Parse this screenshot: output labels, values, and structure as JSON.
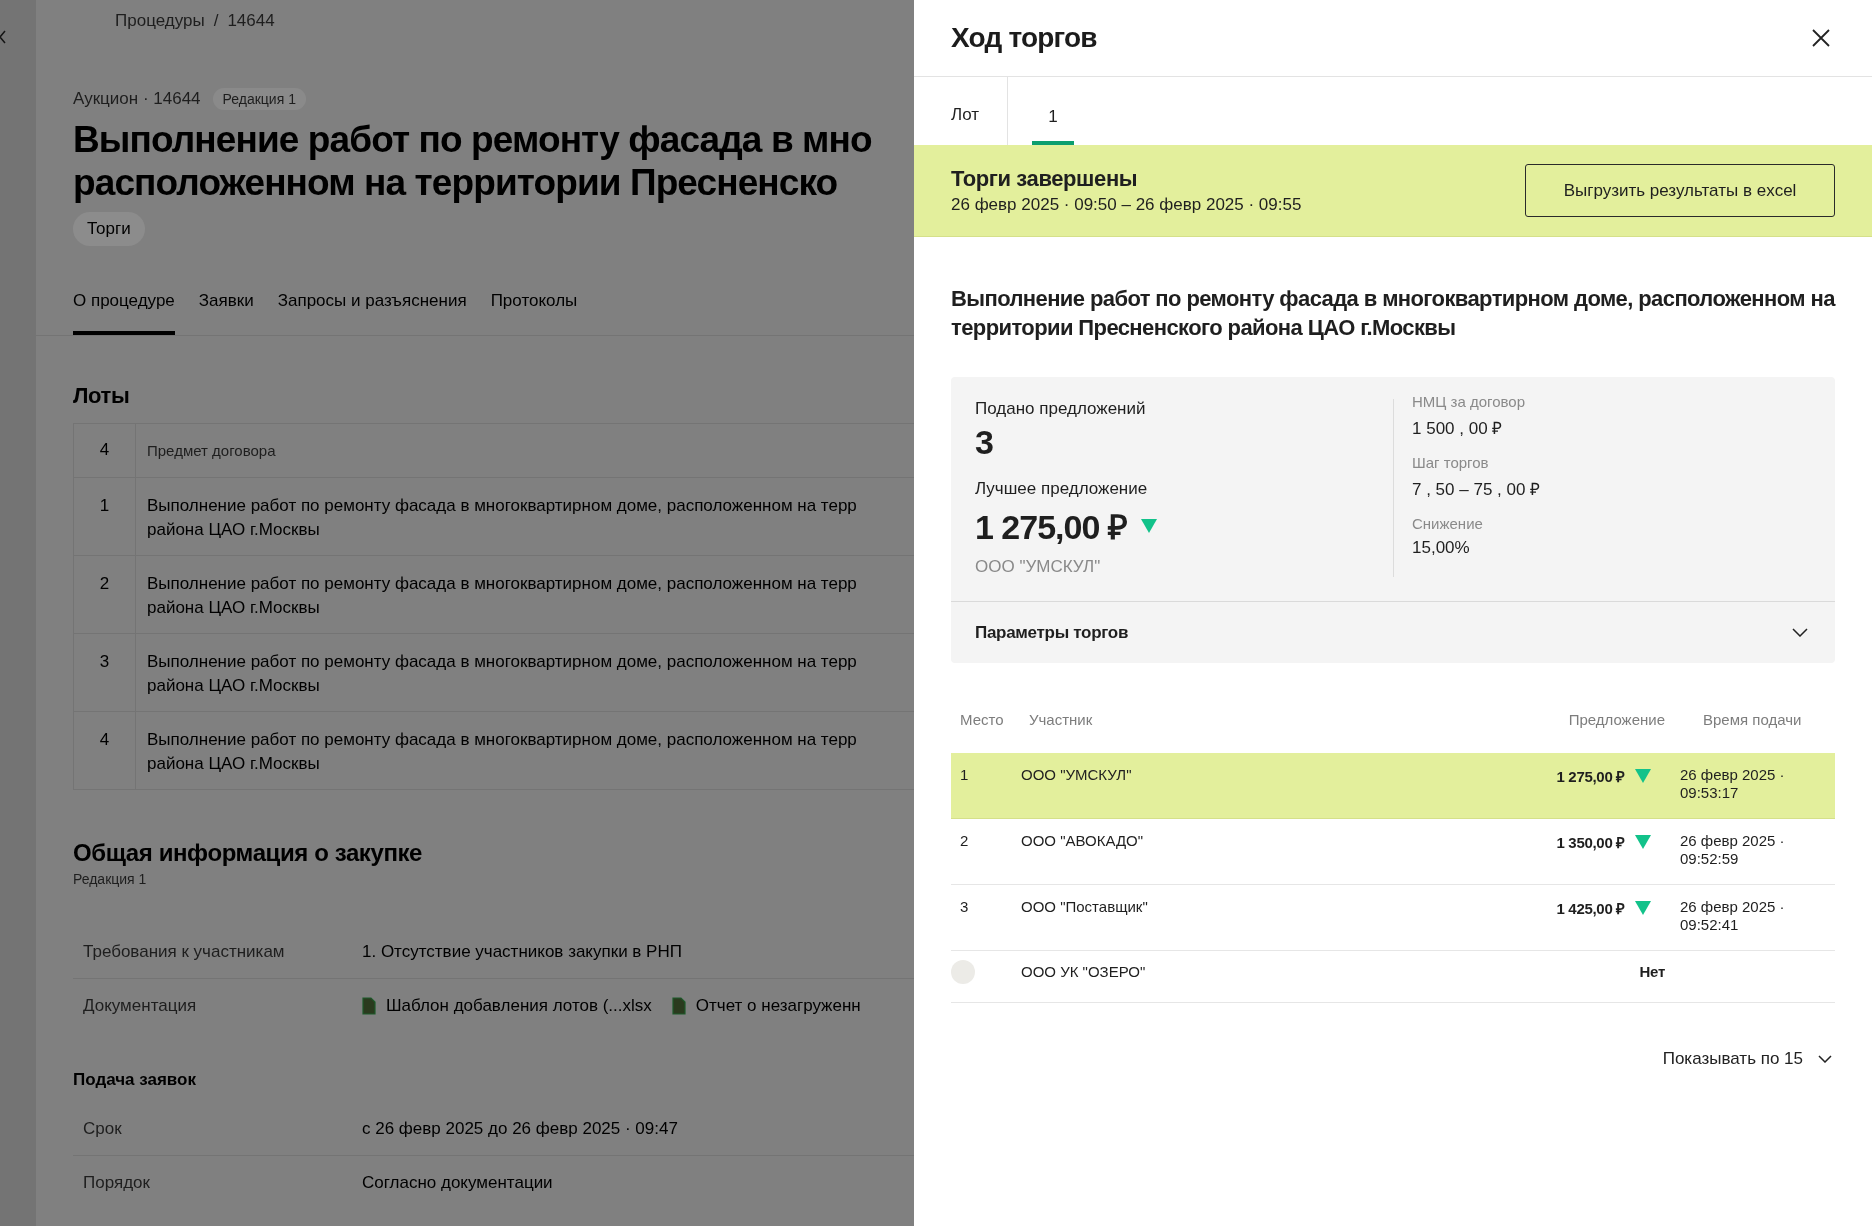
{
  "page": {
    "breadcrumbs": {
      "items": [
        "Процедуры",
        "14644"
      ],
      "separator": "/"
    },
    "meta": "Аукцион · 14644",
    "edition_badge": "Редакция 1",
    "title": "Выполнение работ по ремонту фасада в мно\nрасположенном на территории Пресненско",
    "tag": "Торги",
    "tabs": [
      {
        "label": "О процедуре",
        "selected": true
      },
      {
        "label": "Заявки",
        "selected": false
      },
      {
        "label": "Запросы и разъяснения",
        "selected": false
      },
      {
        "label": "Протоколы",
        "selected": false
      }
    ],
    "lots": {
      "title": "Лоты",
      "header": {
        "number": "4",
        "subject": "Предмет договора"
      },
      "rows": [
        {
          "number": "1",
          "subject": "Выполнение работ по ремонту фасада в многоквартирном доме, расположенном на терр\nрайона ЦАО г.Москвы"
        },
        {
          "number": "2",
          "subject": "Выполнение работ по ремонту фасада в многоквартирном доме, расположенном на терр\nрайона ЦАО г.Москвы"
        },
        {
          "number": "3",
          "subject": "Выполнение работ по ремонту фасада в многоквартирном доме, расположенном на терр\nрайона ЦАО г.Москвы"
        },
        {
          "number": "4",
          "subject": "Выполнение работ по ремонту фасада в многоквартирном доме, расположенном на терр\nрайона ЦАО г.Москвы"
        }
      ]
    },
    "general": {
      "title": "Общая информация о закупке",
      "subtitle": "Редакция 1",
      "rows": [
        {
          "kind": "text",
          "label": "Требования к участникам",
          "value": "1. Отсутствие участников закупки в РНП"
        },
        {
          "kind": "files",
          "label": "Документация",
          "files": [
            "Шаблон добавления лотов (...xlsx",
            "Отчет о незагруженн"
          ]
        }
      ]
    },
    "submission": {
      "title": "Подача заявок",
      "rows": [
        {
          "kind": "text",
          "label": "Срок",
          "value": "с 26 февр 2025 до 26 февр 2025 · 09:47"
        },
        {
          "kind": "text",
          "label": "Порядок",
          "value": "Согласно документации"
        }
      ]
    }
  },
  "drawer": {
    "title": "Ход торгов",
    "lot_label": "Лот",
    "tabs": [
      {
        "label": "1",
        "selected": true
      }
    ],
    "status": {
      "title": "Торги завершены",
      "period": "26 февр 2025 · 09:50 – 26 февр 2025 · 09:55",
      "export_button": "Выгрузить результаты в excel"
    },
    "heading": "Выполнение работ по ремонту фасада в многоквартирном доме, расположенном на территории Пресненского района ЦАО г.Москвы",
    "summary": {
      "bids_label": "Подано предложений",
      "bids_count": "3",
      "best_label": "Лучшее предложение",
      "best_value": "1 275,00 ₽",
      "best_decreased": true,
      "best_company": "ООО \"УМСКУЛ\"",
      "facts": [
        {
          "label": "НМЦ за договор",
          "value": "1 500 , 00 ₽"
        },
        {
          "label": "Шаг торгов",
          "value": "7 , 50 – 75 , 00 ₽"
        },
        {
          "label": "Снижение",
          "value": "15,00%"
        }
      ]
    },
    "params": {
      "title": "Параметры торгов",
      "expanded": false
    },
    "table": {
      "columns": [
        "Место",
        "Участник",
        "Предложение",
        "Время подачи"
      ],
      "rows": [
        {
          "kind": "ranked",
          "place": "1",
          "participant": "ООО \"УМСКУЛ\"",
          "offer": "1 275,00 ₽",
          "decreased": true,
          "time": "26 февр 2025 ·\n09:53:17",
          "highlighted": true
        },
        {
          "kind": "ranked",
          "place": "2",
          "participant": "ООО \"АВОКАДО\"",
          "offer": "1 350,00 ₽",
          "decreased": true,
          "time": "26 февр 2025 ·\n09:52:59",
          "highlighted": false
        },
        {
          "kind": "ranked",
          "place": "3",
          "participant": "ООО \"Поставщик\"",
          "offer": "1 425,00 ₽",
          "decreased": true,
          "time": "26 февр 2025 ·\n09:52:41",
          "highlighted": false
        },
        {
          "kind": "no_bid",
          "participant": "ООО УК \"ОЗЕРО\"",
          "offer": "Нет",
          "highlighted": false
        }
      ]
    },
    "page_size": "Показывать по 15"
  }
}
